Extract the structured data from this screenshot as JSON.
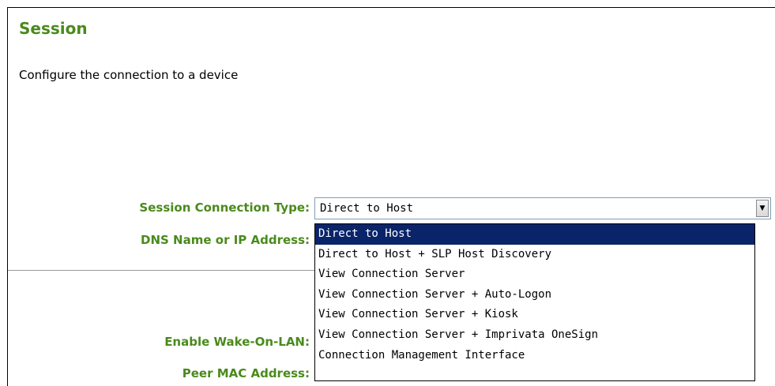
{
  "page": {
    "title": "Session",
    "description": "Configure the connection to a device"
  },
  "form": {
    "labels": {
      "connection_type": "Session Connection Type:",
      "dns": "DNS Name or IP Address:",
      "wake_on_lan": "Enable Wake-On-LAN:",
      "peer_mac": "Peer MAC Address:"
    },
    "connection_type": {
      "selected": "Direct to Host",
      "options": [
        "Direct to Host",
        "Direct to Host + SLP Host Discovery",
        "View Connection Server",
        "View Connection Server + Auto-Logon",
        "View Connection Server + Kiosk",
        "View Connection Server + Imprivata OneSign",
        "Connection Management Interface"
      ]
    }
  },
  "colors": {
    "label_green": "#4a8a1c",
    "selection_blue": "#0a246a"
  }
}
